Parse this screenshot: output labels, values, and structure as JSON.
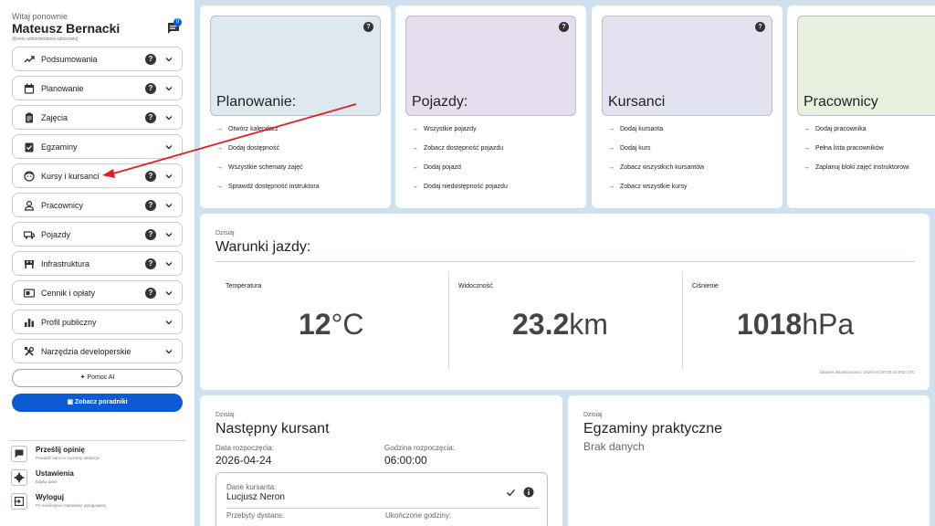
{
  "sidebar": {
    "greeting": "Witaj ponownie",
    "user_name": "Mateusz Bernacki",
    "user_role": "(Konto administratora szkoczeki)",
    "notification_count": "0",
    "items": [
      {
        "label": "Podsumowania",
        "icon": "trend-icon",
        "help": "?"
      },
      {
        "label": "Planowanie",
        "icon": "calendar-icon",
        "help": "?"
      },
      {
        "label": "Zajęcia",
        "icon": "clipboard-icon",
        "help": "?"
      },
      {
        "label": "Egzaminy",
        "icon": "checklist-icon",
        "help": ""
      },
      {
        "label": "Kursy i kursanci",
        "icon": "face-icon",
        "help": "?"
      },
      {
        "label": "Pracownicy",
        "icon": "person-icon",
        "help": "?"
      },
      {
        "label": "Pojazdy",
        "icon": "car-icon",
        "help": "?"
      },
      {
        "label": "Infrastruktura",
        "icon": "building-icon",
        "help": "?"
      },
      {
        "label": "Cennik i opłaty",
        "icon": "money-icon",
        "help": "?"
      },
      {
        "label": "Profil publiczny",
        "icon": "chart-icon",
        "help": ""
      },
      {
        "label": "Narzędzia developerskie",
        "icon": "tools-icon",
        "help": ""
      }
    ],
    "ai_help_label": "Pomoc AI",
    "guides_label": "Zobacz poradniki",
    "feedback_title": "Prześlij opinię",
    "feedback_sub": "Powiedz nam co możemy ulepszyć",
    "settings_title": "Ustawienia",
    "settings_sub": "Edytuj dane",
    "logout_title": "Wyloguj",
    "logout_sub": "Po naciśnięciu zostaniesz wylogowany"
  },
  "quick_cards": [
    {
      "title": "Planowanie:",
      "color": "#dde9ef",
      "help": "?",
      "links": [
        "Otwórz kalendarz",
        "Dodaj dostępność",
        "Wszystkie schematy zajęć",
        "Sprawdź dostępność instruktora"
      ]
    },
    {
      "title": "Pojazdy:",
      "color": "#e6ddef",
      "help": "?",
      "links": [
        "Wszystkie pojazdy",
        "Zobacz dostępność pojazdu",
        "Dodaj pojazd",
        "Dodaj niedostępność pojazdu"
      ]
    },
    {
      "title": "Kursanci",
      "color": "#e3e2f0",
      "help": "?",
      "links": [
        "Dodaj kursanta",
        "Dodaj kurs",
        "Zobacz wszystkich kursantów",
        "Zobacz wszystkie kursy"
      ]
    },
    {
      "title": "Pracownicy",
      "color": "#e8efde",
      "help": "",
      "links": [
        "Dodaj pracownika",
        "Pełna lista pracowników",
        "Zaplanuj bloki zajęć instruktorowi"
      ]
    }
  ],
  "conditions": {
    "today": "Dzisiaj",
    "title": "Warunki jazdy:",
    "temp_label": "Temperatura",
    "temp_value": "12",
    "temp_unit": "°C",
    "vis_label": "Widoczność",
    "vis_value": "23.2",
    "vis_unit": "km",
    "pressure_label": "Ciśnienie",
    "pressure_value": "1018",
    "pressure_unit": "hPa",
    "updated": "Dataset aktualizowano: 2026-04-18T20:42:00Z UTC"
  },
  "next_student": {
    "today": "Dzisiaj",
    "title": "Następny kursant",
    "start_date_label": "Data rozpoczęcia:",
    "start_date": "2026-04-24",
    "start_time_label": "Godzina rozpoczęcia:",
    "start_time": "06:00:00",
    "data_label": "Dane kursanta:",
    "student_name": "Lucjusz Neron",
    "distance_label": "Przebyty dystans:",
    "hours_label": "Ukończone godziny:"
  },
  "exams": {
    "today": "Dzisiaj",
    "title": "Egzaminy praktyczne",
    "empty": "Brak danych"
  },
  "colors": {
    "accent": "#0b5bd3",
    "annotation_arrow": "#e02020",
    "background": "#cfe1ee"
  }
}
